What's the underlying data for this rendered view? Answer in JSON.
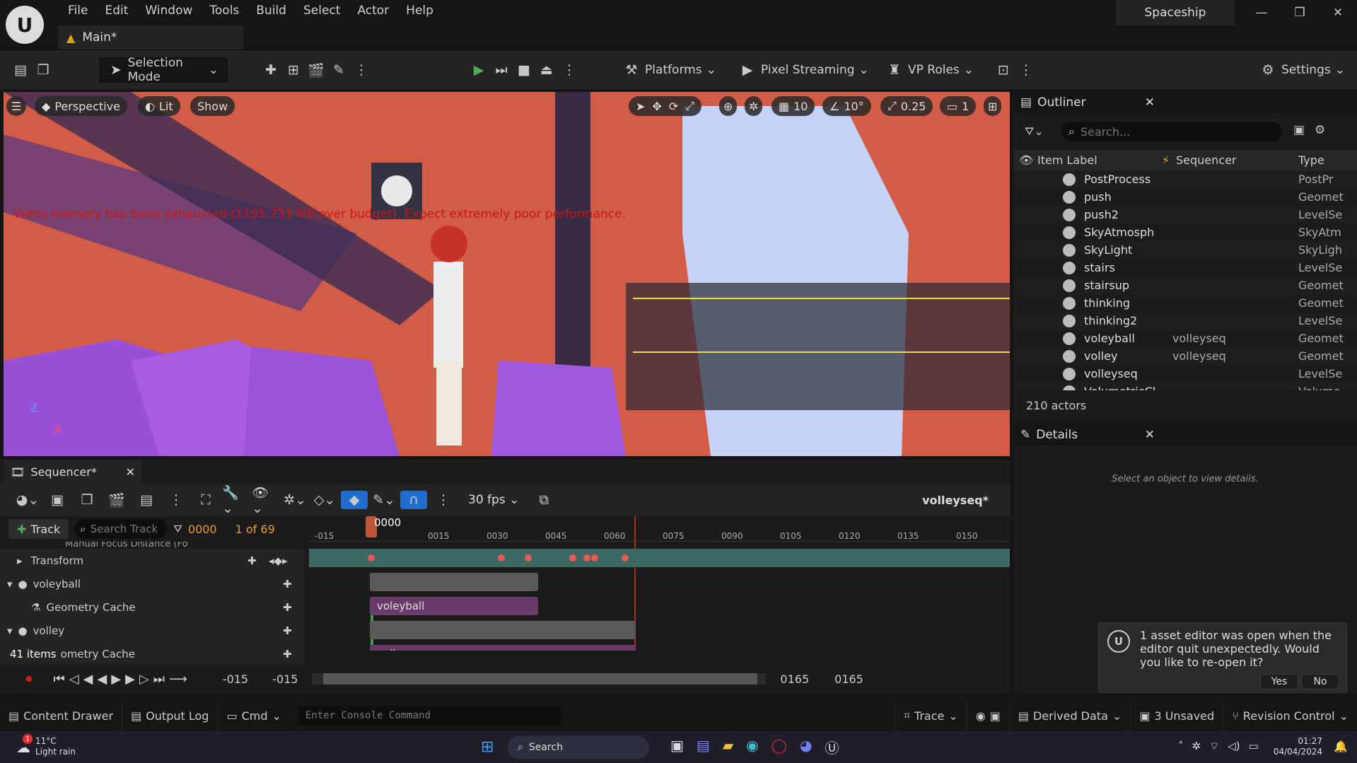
{
  "window": {
    "project_name": "Spaceship",
    "main_tab": "Main*",
    "min": "—",
    "max": "❐",
    "close": "✕"
  },
  "menu": [
    "File",
    "Edit",
    "Window",
    "Tools",
    "Build",
    "Select",
    "Actor",
    "Help"
  ],
  "toolbar": {
    "selection_mode": "Selection Mode",
    "platforms": "Platforms",
    "pixel_streaming": "Pixel Streaming",
    "vp_roles": "VP Roles",
    "settings": "Settings"
  },
  "viewport": {
    "perspective": "Perspective",
    "lit": "Lit",
    "show": "Show",
    "grid_snap": "10",
    "rot_snap": "10°",
    "scale_snap": "0.25",
    "camera_speed": "1",
    "warning": "Video memory has been exhausted (1195.231 MB over budget). Expect extremely poor performance.",
    "axis_z": "Z",
    "axis_x": "X"
  },
  "outliner": {
    "title": "Outliner",
    "search_placeholder": "Search...",
    "col_label": "Item Label",
    "col_sequencer": "Sequencer",
    "col_type": "Type",
    "rows": [
      {
        "label": "PostProcess",
        "seq": "",
        "type": "PostPr"
      },
      {
        "label": "push",
        "seq": "",
        "type": "Geomet"
      },
      {
        "label": "push2",
        "seq": "",
        "type": "LevelSe"
      },
      {
        "label": "SkyAtmosph",
        "seq": "",
        "type": "SkyAtm"
      },
      {
        "label": "SkyLight",
        "seq": "",
        "type": "SkyLigh"
      },
      {
        "label": "stairs",
        "seq": "",
        "type": "LevelSe"
      },
      {
        "label": "stairsup",
        "seq": "",
        "type": "Geomet"
      },
      {
        "label": "thinking",
        "seq": "",
        "type": "Geomet"
      },
      {
        "label": "thinking2",
        "seq": "",
        "type": "LevelSe"
      },
      {
        "label": "voleyball",
        "seq": "volleyseq",
        "type": "Geomet"
      },
      {
        "label": "volley",
        "seq": "volleyseq",
        "type": "Geomet"
      },
      {
        "label": "volleyseq",
        "seq": "",
        "type": "LevelSe"
      },
      {
        "label": "VolumetricCl",
        "seq": "",
        "type": "Volume"
      }
    ],
    "count": "210 actors"
  },
  "details": {
    "title": "Details",
    "empty": "Select an object to view details."
  },
  "sequencer": {
    "title": "Sequencer*",
    "fps": "30 fps",
    "sequence": "volleyseq*",
    "track_btn": "Track",
    "search_placeholder": "Search Tracks",
    "current_frame": "0000",
    "frame_count": "1 of 69",
    "playhead": "0000",
    "ruler": [
      "-015",
      "0015",
      "0030",
      "0045",
      "0060",
      "0075",
      "0090",
      "0105",
      "0120",
      "0135",
      "0150"
    ],
    "cut_row": "Manual Focus Distance (Fo",
    "tracks": [
      "Transform",
      "voleyball",
      "Geometry Cache",
      "volley",
      "ometry Cache"
    ],
    "items": "41 items",
    "clip_voleyball": "voleyball",
    "clip_volley": "volley",
    "range_start": "-015",
    "range_start2": "-015",
    "range_end": "0165",
    "range_end2": "0165"
  },
  "status": {
    "content_drawer": "Content Drawer",
    "output_log": "Output Log",
    "cmd": "Cmd",
    "console_placeholder": "Enter Console Command",
    "trace": "Trace",
    "derived_data": "Derived Data",
    "unsaved": "3 Unsaved",
    "revision": "Revision Control"
  },
  "notification": {
    "text": "1 asset editor was open when the editor quit unexpectedly. Would you like to re-open it?",
    "yes": "Yes",
    "no": "No"
  },
  "taskbar": {
    "temp": "11°C",
    "weather": "Light rain",
    "search": "Search",
    "time": "01:27",
    "date": "04/04/2024",
    "badge": "1"
  }
}
